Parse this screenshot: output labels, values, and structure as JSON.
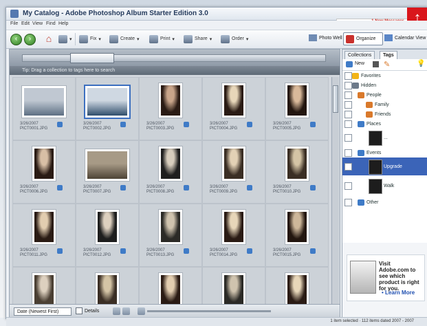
{
  "window": {
    "title": "My Catalog - Adobe Photoshop Album Starter Edition 3.0",
    "notice": "1 New Messages"
  },
  "menu": [
    "File",
    "Edit",
    "View",
    "Find",
    "Help"
  ],
  "toolbar": {
    "fix": "Fix",
    "create": "Create",
    "print": "Print",
    "share": "Share",
    "order": "Order",
    "photo_well": "Photo Well",
    "organize": "Organize",
    "calendar": "Calendar View"
  },
  "browser": {
    "hint": "Tip: Drag a collection to tags here to search"
  },
  "photos": [
    {
      "caption": "3/26/2007\nPICT0001.JPG",
      "kind": "landscape",
      "c1": "#5d6f83",
      "c2": "#c0c8d2",
      "selected": false
    },
    {
      "caption": "3/26/2007\nPICT0002.JPG",
      "kind": "landscape",
      "c1": "#2f4d6b",
      "c2": "#cfd8e2",
      "selected": true
    },
    {
      "caption": "3/26/2007\nPICT0003.JPG",
      "kind": "portrait",
      "c1": "#2a1b14",
      "c2": "#c9a58a",
      "selected": false
    },
    {
      "caption": "3/26/2007\nPICT0004.JPG",
      "kind": "portrait",
      "c1": "#2a1b14",
      "c2": "#e7d6b9",
      "selected": false
    },
    {
      "caption": "3/26/2007\nPICT0005.JPG",
      "kind": "portrait",
      "c1": "#23160f",
      "c2": "#d9b99a",
      "selected": false
    },
    {
      "caption": "3/26/2007\nPICT0006.JPG",
      "kind": "portrait",
      "c1": "#2a1b14",
      "c2": "#d8bfa5",
      "selected": false
    },
    {
      "caption": "3/26/2007\nPICT0007.JPG",
      "kind": "landscape",
      "c1": "#4d4335",
      "c2": "#a79a86",
      "selected": false
    },
    {
      "caption": "3/26/2007\nPICT0008.JPG",
      "kind": "portrait",
      "c1": "#1e1e1e",
      "c2": "#d7cdbd",
      "selected": false
    },
    {
      "caption": "3/26/2007\nPICT0009.JPG",
      "kind": "portrait",
      "c1": "#3a2e24",
      "c2": "#e3d1b5",
      "selected": false
    },
    {
      "caption": "3/26/2007\nPICT0010.JPG",
      "kind": "portrait",
      "c1": "#3a2e24",
      "c2": "#d4c4a5",
      "selected": false
    },
    {
      "caption": "3/26/2007\nPICT0011.JPG",
      "kind": "portrait",
      "c1": "#2a1b14",
      "c2": "#e2cdb0",
      "selected": false
    },
    {
      "caption": "3/26/2007\nPICT0012.JPG",
      "kind": "portrait",
      "c1": "#1e1e1e",
      "c2": "#ddd0bf",
      "selected": false
    },
    {
      "caption": "3/26/2007\nPICT0013.JPG",
      "kind": "portrait",
      "c1": "#2b2a26",
      "c2": "#cfc3ae",
      "selected": false
    },
    {
      "caption": "3/26/2007\nPICT0014.JPG",
      "kind": "portrait",
      "c1": "#2a1b14",
      "c2": "#e7d6b9",
      "selected": false
    },
    {
      "caption": "3/26/2007\nPICT0015.JPG",
      "kind": "portrait",
      "c1": "#23160f",
      "c2": "#cdb79a",
      "selected": false
    },
    {
      "caption": "",
      "kind": "portrait",
      "c1": "#4a3f33",
      "c2": "#ddd0bf",
      "selected": false
    },
    {
      "caption": "",
      "kind": "portrait",
      "c1": "#3a2e24",
      "c2": "#d4c4a5",
      "selected": false
    },
    {
      "caption": "",
      "kind": "portrait",
      "c1": "#2a1b14",
      "c2": "#e2cdb0",
      "selected": false
    },
    {
      "caption": "",
      "kind": "portrait",
      "c1": "#2b2a26",
      "c2": "#cfc3ae",
      "selected": false
    },
    {
      "caption": "",
      "kind": "portrait",
      "c1": "#2a1b14",
      "c2": "#e7d6b9",
      "selected": false
    }
  ],
  "bottombar": {
    "sort": "Date (Newest First)",
    "details": "Details"
  },
  "panel": {
    "tab_collections": "Collections",
    "tab_tags": "Tags",
    "new_label": "New"
  },
  "tags": [
    {
      "label": "Favorites",
      "icon_color": "#f2b417"
    },
    {
      "label": "Hidden",
      "icon_color": "#6d7a8a"
    },
    {
      "label": "People",
      "icon_color": "#d9792b"
    },
    {
      "label": "Family",
      "icon_color": "#d9792b"
    },
    {
      "label": "Friends",
      "icon_color": "#d9792b"
    },
    {
      "label": "Places",
      "icon_color": "#3f7bc7"
    },
    {
      "label": "...",
      "icon_color": "#3f7bc7"
    },
    {
      "label": "Events",
      "icon_color": "#3f7bc7"
    },
    {
      "label": "Upgrade",
      "icon_color": "#3f7bc7"
    },
    {
      "label": "Walk",
      "icon_color": "#3f7bc7"
    },
    {
      "label": "Other",
      "icon_color": "#3f7bc7"
    }
  ],
  "promo": {
    "text": "Visit Adobe.com to see which product is right for you.",
    "link": "Learn More"
  },
  "status": {
    "text": "1 item selected · 112 items dated 2007 - 2007"
  }
}
